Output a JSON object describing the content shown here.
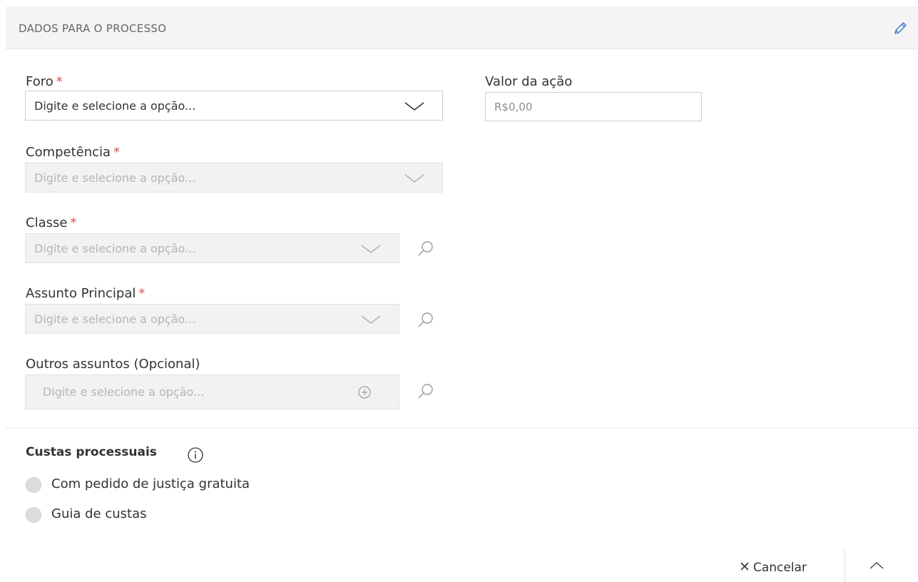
{
  "header": {
    "title": "DADOS PARA O PROCESSO"
  },
  "fields": {
    "foro": {
      "label": "Foro",
      "required_mark": "*",
      "placeholder": "Digite e selecione a opção..."
    },
    "competencia": {
      "label": "Competência",
      "required_mark": "*",
      "placeholder": "Digite e selecione a opção..."
    },
    "classe": {
      "label": "Classe",
      "required_mark": "*",
      "placeholder": "Digite e selecione a opção..."
    },
    "assunto_principal": {
      "label": "Assunto Principal",
      "required_mark": "*",
      "placeholder": "Digite e selecione a opção..."
    },
    "outros_assuntos": {
      "label": "Outros assuntos (Opcional)",
      "placeholder": "Digite e selecione a opção..."
    },
    "valor_acao": {
      "label": "Valor da ação",
      "placeholder": "R$0,00"
    }
  },
  "custas": {
    "title": "Custas processuais",
    "options": [
      {
        "label": "Com pedido de justiça gratuita"
      },
      {
        "label": "Guia de custas"
      }
    ]
  },
  "footer": {
    "cancel_label": "Cancelar"
  },
  "icons": {
    "edit": "pencil-icon",
    "dropdown": "chevron-down-icon",
    "search": "magnifier-icon",
    "add": "circle-plus-icon",
    "info": "info-icon",
    "cancel": "close-icon",
    "collapse": "chevron-up-icon"
  },
  "colors": {
    "accent": "#3a78c9",
    "required": "#d9534f",
    "header_bg": "#f4f4f4",
    "disabled_bg": "#f2f2f2"
  }
}
